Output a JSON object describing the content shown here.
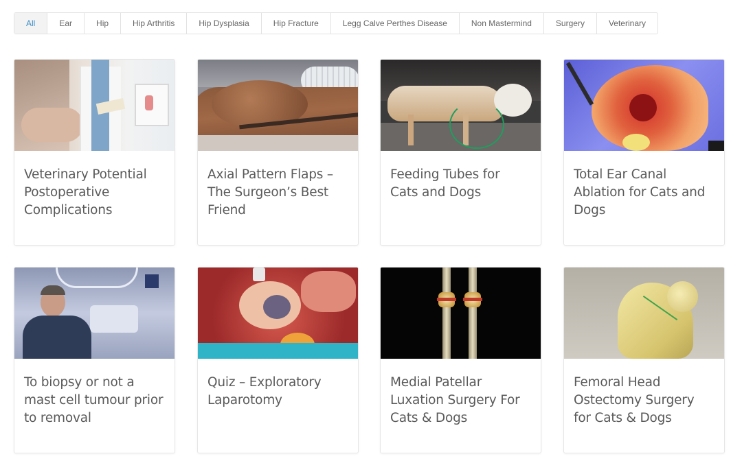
{
  "filters": {
    "items": [
      "All",
      "Ear",
      "Hip",
      "Hip Arthritis",
      "Hip Dysplasia",
      "Hip Fracture",
      "Legg Calve Perthes Disease",
      "Non Mastermind",
      "Surgery",
      "Veterinary"
    ],
    "active": "All"
  },
  "cards": [
    {
      "title": "Veterinary Potential Postoperative Complications",
      "image": "clinic-consultation-photo"
    },
    {
      "title": "Axial Pattern Flaps – The Surgeon’s Best Friend",
      "image": "skin-flap-surgery-photo"
    },
    {
      "title": "Feeding Tubes for Cats and Dogs",
      "image": "thin-dog-feeding-tube-photo"
    },
    {
      "title": "Total Ear Canal Ablation for Cats and Dogs",
      "image": "ear-surgery-photo"
    },
    {
      "title": "To biopsy or not a mast cell tumour prior to removal",
      "image": "presenter-in-operating-theatre-photo"
    },
    {
      "title": "Quiz – Exploratory Laparotomy",
      "image": "abdominal-surgery-photo"
    },
    {
      "title": "Medial Patellar Luxation Surgery For Cats & Dogs",
      "image": "hindlimb-bones-3d-render"
    },
    {
      "title": "Femoral Head Ostectomy Surgery for Cats & Dogs",
      "image": "femur-bone-model-photo"
    }
  ],
  "colors": {
    "accent": "#3f8fc4",
    "title_text": "#5a5a5a",
    "border": "#e2e2e2"
  }
}
